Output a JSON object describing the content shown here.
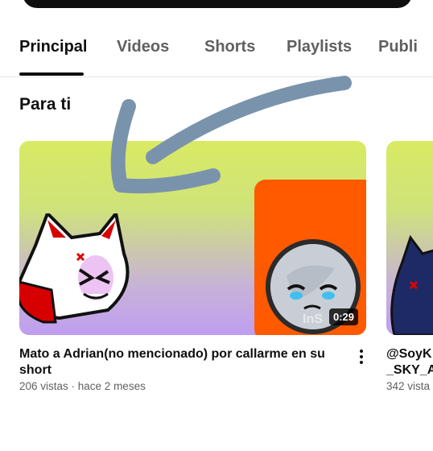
{
  "tabs": [
    {
      "label": "Principal",
      "active": true
    },
    {
      "label": "Videos"
    },
    {
      "label": "Shorts"
    },
    {
      "label": "Playlists"
    },
    {
      "label": "Publi"
    }
  ],
  "section": {
    "title": "Para ti"
  },
  "videos": [
    {
      "title_line1": "Mato a Adrian(no mencionado) por callarme en su",
      "title_line2": "short",
      "meta": "206 vistas · hace 2 meses",
      "duration": "0:29",
      "watermark": "InS"
    },
    {
      "title_line1": "@SoyK",
      "title_line2": "_SKY_A",
      "meta": "342 vista"
    }
  ],
  "colors": {
    "accent": "#0f0f0f",
    "muted": "#606060",
    "arrow": "#7a93ad",
    "thumb_orange": "#ff5a00"
  },
  "icons": [
    "more-vert-icon",
    "hand-drawn-arrow"
  ]
}
